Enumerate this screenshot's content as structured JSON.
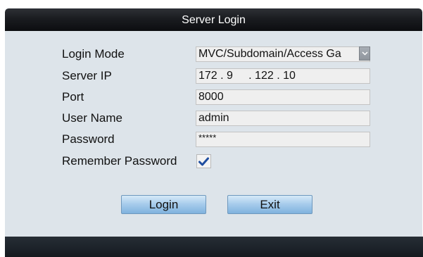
{
  "title": "Server Login",
  "fields": {
    "login_mode": {
      "label": "Login Mode",
      "value": "MVC/Subdomain/Access Ga"
    },
    "server_ip": {
      "label": "Server IP",
      "value": "172 . 9     . 122 . 10"
    },
    "port": {
      "label": "Port",
      "value": "8000"
    },
    "user_name": {
      "label": "User Name",
      "value": "admin"
    },
    "password": {
      "label": "Password",
      "value": "*****"
    },
    "remember_password": {
      "label": "Remember Password",
      "checked": true
    }
  },
  "buttons": {
    "login": "Login",
    "exit": "Exit"
  },
  "icons": {
    "dropdown": "chevron-down-icon",
    "check": "checkmark-icon"
  },
  "colors": {
    "checkmark": "#1f4ea0",
    "button": "#a9cdec",
    "panel": "#dde4ea"
  }
}
